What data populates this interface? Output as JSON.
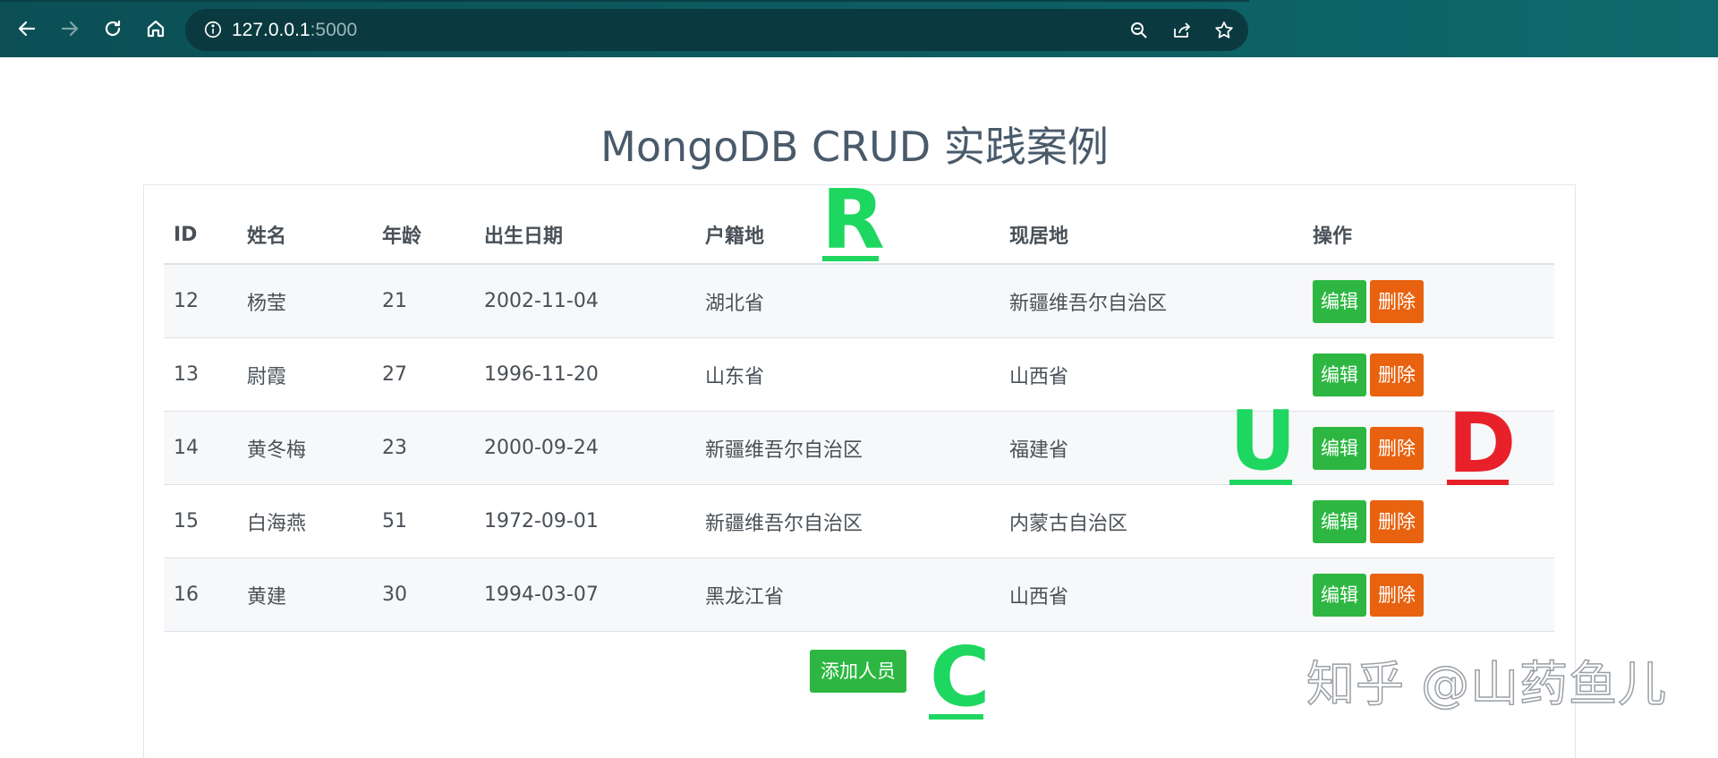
{
  "browser": {
    "url_host": "127.0.0.1",
    "url_port": ":5000"
  },
  "page": {
    "title": "MongoDB CRUD 实践案例"
  },
  "table": {
    "columns": [
      "ID",
      "姓名",
      "年龄",
      "出生日期",
      "户籍地",
      "现居地",
      "操作"
    ],
    "rows": [
      {
        "id": "12",
        "name": "杨莹",
        "age": "21",
        "birth": "2002-11-04",
        "hometown": "湖北省",
        "residence": "新疆维吾尔自治区"
      },
      {
        "id": "13",
        "name": "尉霞",
        "age": "27",
        "birth": "1996-11-20",
        "hometown": "山东省",
        "residence": "山西省"
      },
      {
        "id": "14",
        "name": "黄冬梅",
        "age": "23",
        "birth": "2000-09-24",
        "hometown": "新疆维吾尔自治区",
        "residence": "福建省"
      },
      {
        "id": "15",
        "name": "白海燕",
        "age": "51",
        "birth": "1972-09-01",
        "hometown": "新疆维吾尔自治区",
        "residence": "内蒙古自治区"
      },
      {
        "id": "16",
        "name": "黄建",
        "age": "30",
        "birth": "1994-03-07",
        "hometown": "黑龙江省",
        "residence": "山西省"
      }
    ],
    "edit_label": "编辑",
    "delete_label": "删除"
  },
  "add_button_label": "添加人员",
  "annotations": {
    "r": "R",
    "u": "U",
    "d": "D",
    "c": "C",
    "green": "#1ed760",
    "red": "#e8202a"
  },
  "watermark": "知乎 @山药鱼儿",
  "colors": {
    "edit": "#2db742",
    "delete": "#e8620f",
    "chrome": "#0d5e63"
  }
}
